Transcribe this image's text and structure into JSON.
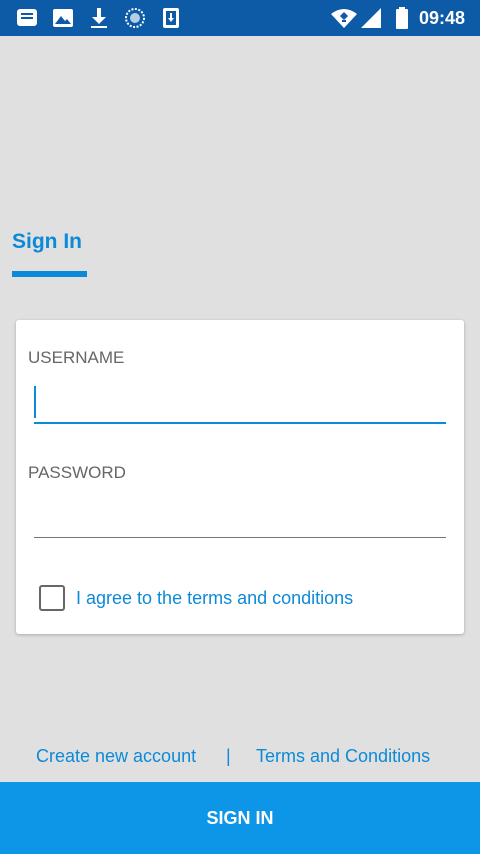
{
  "status_bar": {
    "time": "09:48",
    "icons": [
      "message-icon",
      "image-icon",
      "download-icon",
      "sync-icon",
      "sim-download-icon",
      "wifi-icon",
      "signal-icon",
      "battery-icon"
    ]
  },
  "header": {
    "title": "Sign In"
  },
  "form": {
    "username_label": "USERNAME",
    "username_value": "",
    "password_label": "PASSWORD",
    "password_value": "",
    "terms_checkbox_label": "I agree to the terms and conditions",
    "terms_checked": false
  },
  "footer": {
    "create_account_label": "Create new account",
    "separator": "|",
    "terms_link_label": "Terms and Conditions"
  },
  "sign_in_button": {
    "label": "SIGN IN"
  },
  "colors": {
    "status_bar": "#0d5aa7",
    "accent": "#0d8ad7",
    "button": "#0d96e8",
    "background": "#e0e0e0"
  }
}
